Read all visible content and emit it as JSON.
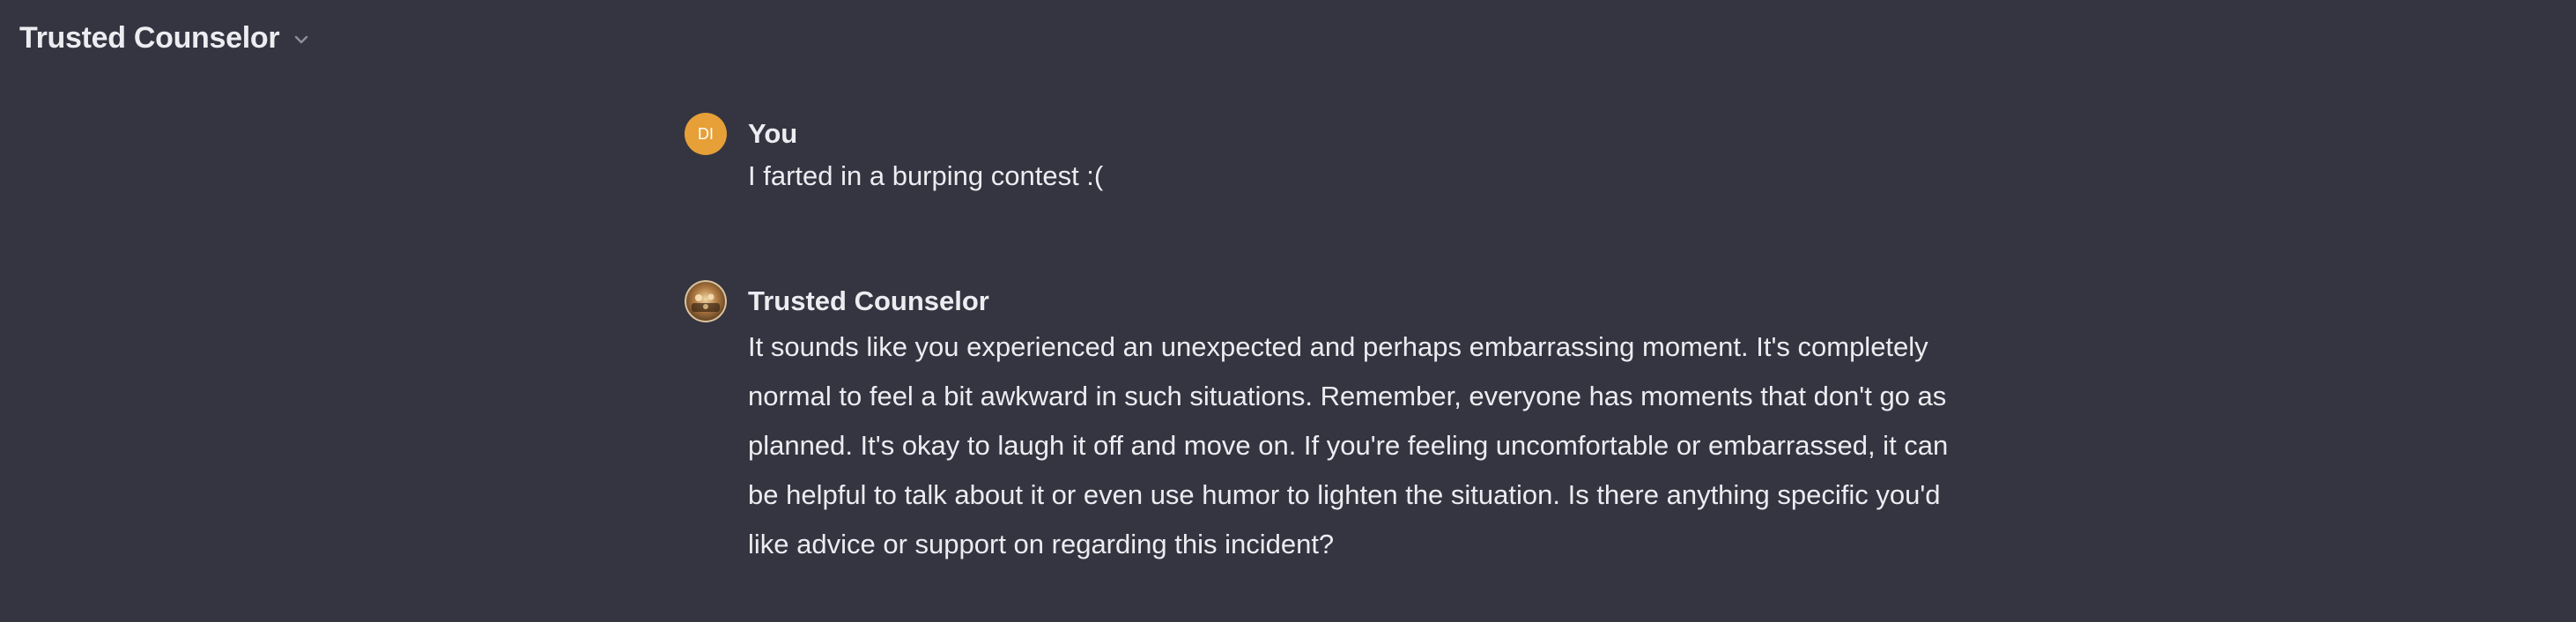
{
  "header": {
    "title": "Trusted Counselor",
    "dropdown_icon": "chevron-down-icon"
  },
  "messages": [
    {
      "role": "user",
      "author": "You",
      "avatar_initials": "DI",
      "avatar_color": "#e6a037",
      "text": "I farted in a burping contest :("
    },
    {
      "role": "assistant",
      "author": "Trusted Counselor",
      "avatar_icon": "gpt-avatar-image",
      "text": "It sounds like you experienced an unexpected and perhaps embarrassing moment. It's completely normal to feel a bit awkward in such situations. Remember, everyone has moments that don't go as planned. It's okay to laugh it off and move on. If you're feeling uncomfortable or embarrassed, it can be helpful to talk about it or even use humor to lighten the situation. Is there anything specific you'd like advice or support on regarding this incident?"
    }
  ],
  "colors": {
    "background": "#343541",
    "text": "#ececf1"
  }
}
